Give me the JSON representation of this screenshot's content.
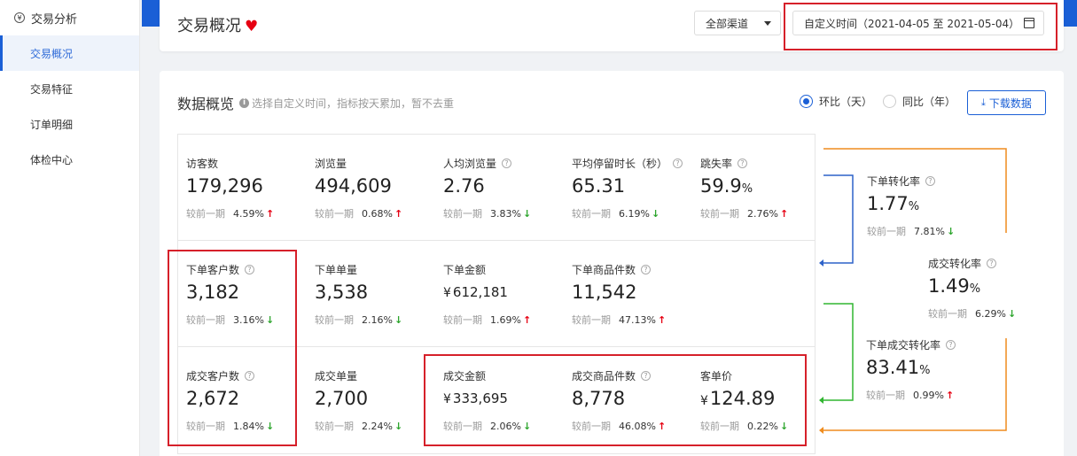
{
  "sidebar": {
    "title": "交易分析",
    "items": [
      {
        "label": "交易概况",
        "active": true
      },
      {
        "label": "交易特征",
        "active": false
      },
      {
        "label": "订单明细",
        "active": false
      },
      {
        "label": "体检中心",
        "active": false
      }
    ]
  },
  "header": {
    "title": "交易概况",
    "channel": "全部渠道",
    "date_range": "自定义时间（2021-04-05 至 2021-05-04）"
  },
  "overview": {
    "title": "数据概览",
    "hint": "选择自定义时间，指标按天累加，暂不去重",
    "radio_day": "环比（天）",
    "radio_year": "同比（年）",
    "download": "下载数据",
    "compare_label": "较前一期"
  },
  "metrics": {
    "visitors": {
      "label": "访客数",
      "value": "179,296",
      "pct": "4.59%",
      "trend": "up"
    },
    "pageviews": {
      "label": "浏览量",
      "value": "494,609",
      "pct": "0.68%",
      "trend": "up"
    },
    "avg_pv": {
      "label": "人均浏览量",
      "value": "2.76",
      "pct": "3.83%",
      "trend": "down"
    },
    "avg_stay": {
      "label": "平均停留时长（秒）",
      "value": "65.31",
      "pct": "6.19%",
      "trend": "down"
    },
    "bounce": {
      "label": "跳失率",
      "value": "59.9",
      "unit": "%",
      "pct": "2.76%",
      "trend": "up"
    },
    "order_customers": {
      "label": "下单客户数",
      "value": "3,182",
      "pct": "3.16%",
      "trend": "down"
    },
    "order_count": {
      "label": "下单单量",
      "value": "3,538",
      "pct": "2.16%",
      "trend": "down"
    },
    "order_amount": {
      "label": "下单金额",
      "currency": "¥",
      "value": "612,181",
      "pct": "1.69%",
      "trend": "up"
    },
    "order_items": {
      "label": "下单商品件数",
      "value": "11,542",
      "pct": "47.13%",
      "trend": "up"
    },
    "deal_customers": {
      "label": "成交客户数",
      "value": "2,672",
      "pct": "1.84%",
      "trend": "down"
    },
    "deal_count": {
      "label": "成交单量",
      "value": "2,700",
      "pct": "2.24%",
      "trend": "down"
    },
    "deal_amount": {
      "label": "成交金额",
      "currency": "¥",
      "value": "333,695",
      "pct": "2.06%",
      "trend": "down"
    },
    "deal_items": {
      "label": "成交商品件数",
      "value": "8,778",
      "pct": "46.08%",
      "trend": "up"
    },
    "unit_price": {
      "label": "客单价",
      "currency": "¥",
      "value": "124.89",
      "pct": "0.22%",
      "trend": "down"
    }
  },
  "funnel": {
    "order_rate": {
      "label": "下单转化率",
      "value": "1.77",
      "unit": "%",
      "pct": "7.81%",
      "trend": "down"
    },
    "deal_rate": {
      "label": "成交转化率",
      "value": "1.49",
      "unit": "%",
      "pct": "6.29%",
      "trend": "down"
    },
    "order_deal_rate": {
      "label": "下单成交转化率",
      "value": "83.41",
      "unit": "%",
      "pct": "0.99%",
      "trend": "up"
    }
  },
  "colors": {
    "accent": "#1a5fd6",
    "up": "#e60012",
    "down": "#2ca52c",
    "highlight": "#d6202a",
    "blue_line": "#2d62c9",
    "green_line": "#31b531",
    "orange_line": "#ef8c1e"
  }
}
